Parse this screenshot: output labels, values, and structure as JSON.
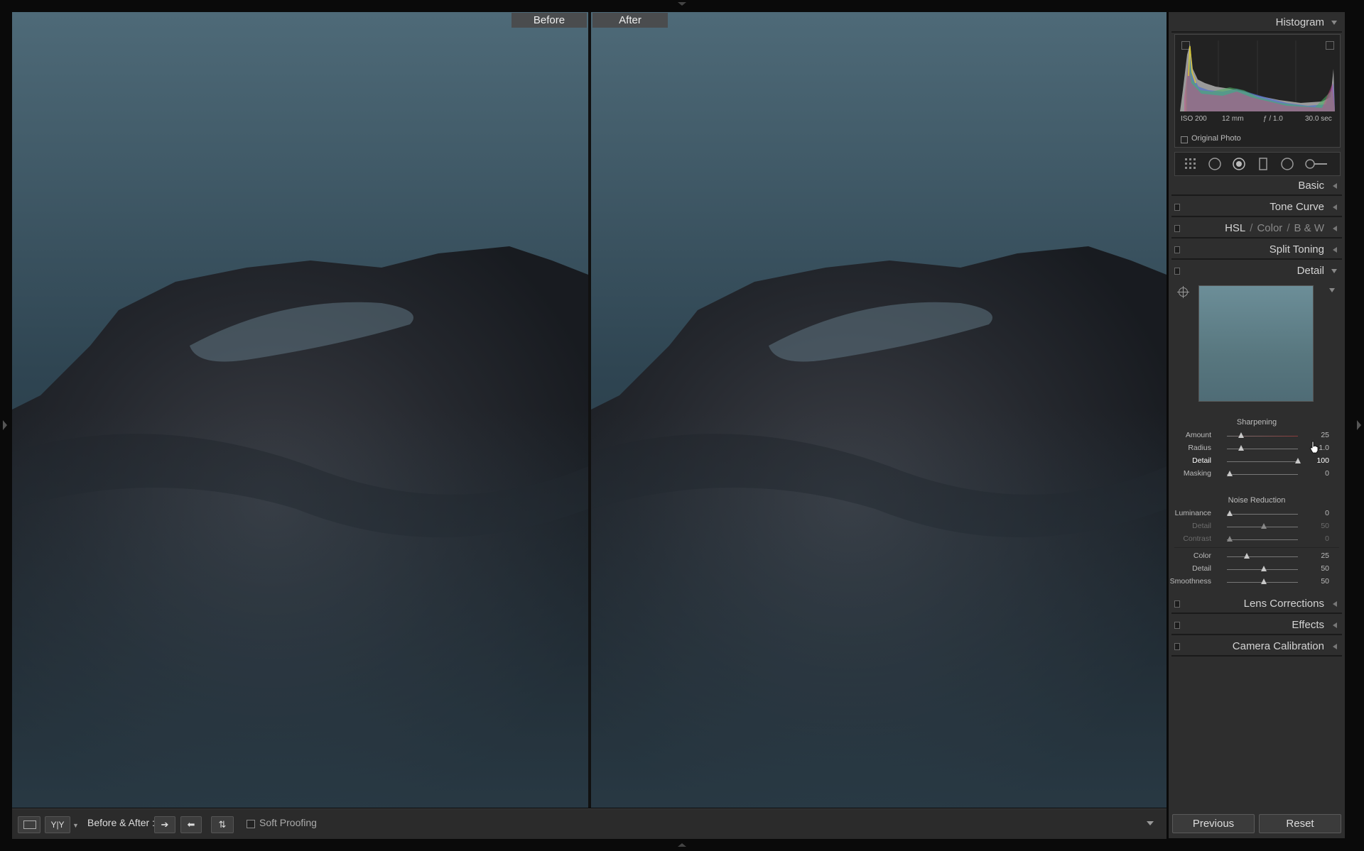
{
  "view": {
    "before_label": "Before",
    "after_label": "After"
  },
  "toolbar": {
    "yy_label": "Y|Y",
    "before_after_label": "Before & After :",
    "soft_proofing_label": "Soft Proofing",
    "copy_before_to_after_icon": "arrow-right-icon",
    "copy_after_to_before_icon": "arrow-left-icon",
    "swap_icon": "swap-icon"
  },
  "histogram": {
    "title": "Histogram",
    "iso": "ISO 200",
    "focal_length": "12 mm",
    "aperture": "ƒ / 1.0",
    "shutter": "30.0 sec",
    "original_photo_label": "Original Photo"
  },
  "tools": [
    "grid-icon",
    "crop-icon",
    "spot-removal-icon",
    "red-eye-icon",
    "graduated-filter-icon",
    "radial-filter-icon",
    "adjustment-brush-icon"
  ],
  "panels": {
    "basic": "Basic",
    "tone_curve": "Tone Curve",
    "hsl": "HSL",
    "color": "Color",
    "bw": "B & W",
    "split_toning": "Split Toning",
    "detail": "Detail",
    "lens_corrections": "Lens Corrections",
    "effects": "Effects",
    "camera_calibration": "Camera Calibration"
  },
  "detail": {
    "sharpening_title": "Sharpening",
    "sharpening": [
      {
        "label": "Amount",
        "value": "25",
        "fraction": 0.167
      },
      {
        "label": "Radius",
        "value": "1.0",
        "fraction": 0.167
      },
      {
        "label": "Detail",
        "value": "100",
        "fraction": 1.0
      },
      {
        "label": "Masking",
        "value": "0",
        "fraction": 0.0
      }
    ],
    "noise_title": "Noise Reduction",
    "noise_luminance": [
      {
        "label": "Luminance",
        "value": "0",
        "fraction": 0.0
      },
      {
        "label": "Detail",
        "value": "50",
        "fraction": 0.5
      },
      {
        "label": "Contrast",
        "value": "0",
        "fraction": 0.0
      }
    ],
    "noise_color": [
      {
        "label": "Color",
        "value": "25",
        "fraction": 0.25
      },
      {
        "label": "Detail",
        "value": "50",
        "fraction": 0.5
      },
      {
        "label": "Smoothness",
        "value": "50",
        "fraction": 0.5
      }
    ]
  },
  "buttons": {
    "previous": "Previous",
    "reset": "Reset"
  }
}
